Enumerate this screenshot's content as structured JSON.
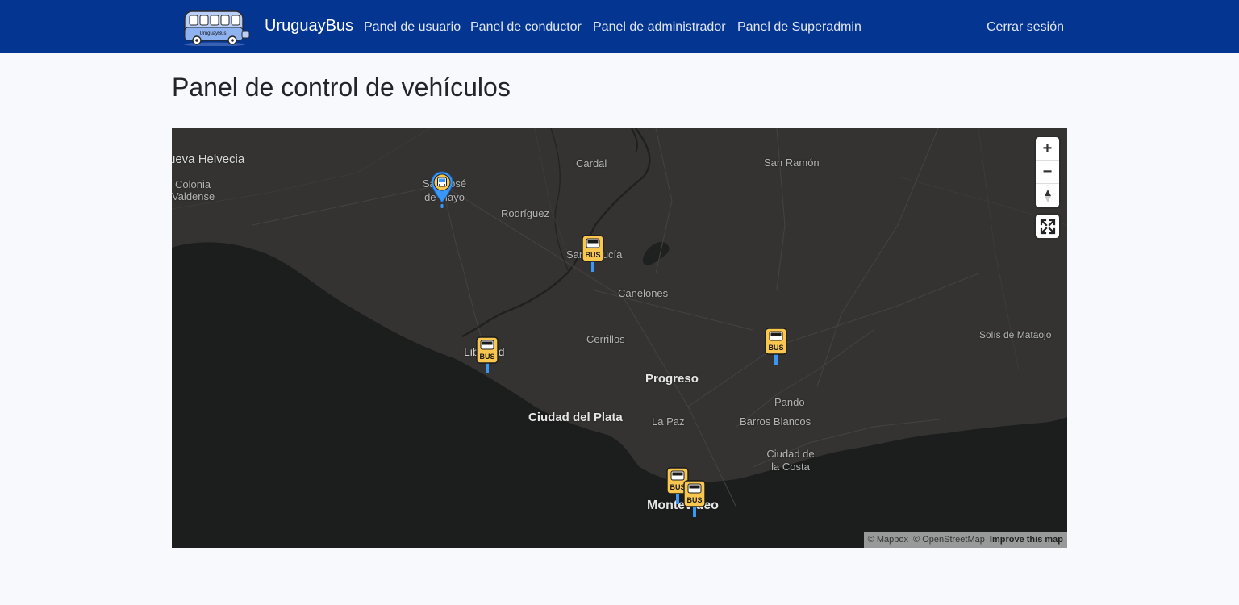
{
  "navbar": {
    "brand": "UruguayBus",
    "logo_text": "UruguayBus",
    "links": [
      "Panel de usuario",
      "Panel de conductor",
      "Panel de administrador",
      "Panel de Superadmin"
    ],
    "logout": "Cerrar sesión",
    "bg_color": "#043591"
  },
  "page": {
    "title": "Panel de control de vehículos"
  },
  "map": {
    "places": {
      "nueva_helvecia": "ueva Helvecia",
      "colonia_valdense_1": "Colonia",
      "colonia_valdense_2": "Valdense",
      "san_jose_1": "San José",
      "san_jose_2": "de Mayo",
      "cardal": "Cardal",
      "san_ramon": "San Ramón",
      "rodriguez": "Rodríguez",
      "santa_lucia": "Santa Lucía",
      "canelones": "Canelones",
      "cerrillos": "Cerrillos",
      "libertad": "Libertad",
      "solis": "Solís de Mataojo",
      "progreso": "Progreso",
      "pando": "Pando",
      "ciudad_del_plata": "Ciudad del Plata",
      "la_paz": "La Paz",
      "barros_blancos": "Barros Blancos",
      "ciudad_costa_1": "Ciudad de",
      "ciudad_costa_2": "la Costa",
      "montevideo": "Montevideo"
    },
    "markers": {
      "bus_stop_label": "BUS",
      "count_stops": 6,
      "vehicle_marker_icon": "bus-location-pin-icon",
      "stop_marker_icon": "bus-stop-sign-icon"
    },
    "controls": {
      "zoom_in": "+",
      "zoom_out": "−",
      "compass_icon": "compass-icon",
      "fullscreen_icon": "fullscreen-icon"
    },
    "attribution": {
      "mapbox": "© Mapbox",
      "osm": "© OpenStreetMap",
      "improve": "Improve this map"
    },
    "colors": {
      "land": "#343332",
      "water": "#1c1d1d",
      "marker_yellow": "#f9c74f",
      "marker_blue": "#3a97f5"
    }
  }
}
